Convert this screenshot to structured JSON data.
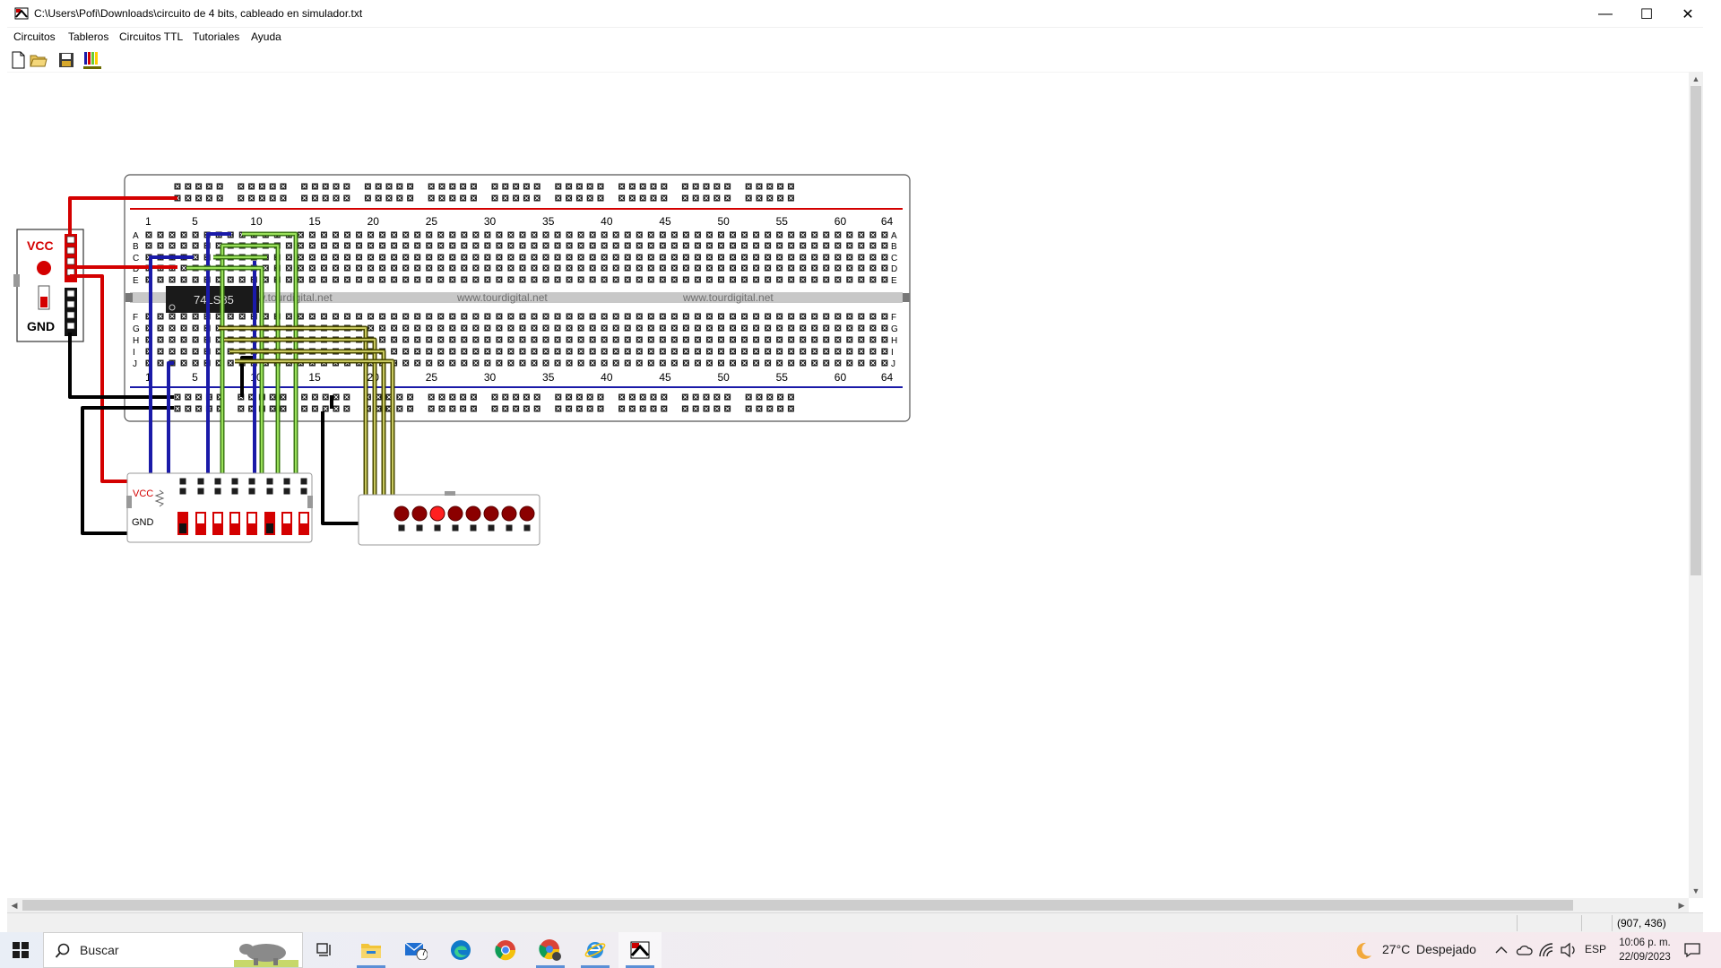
{
  "window": {
    "title": "C:\\Users\\Pofi\\Downloads\\circuito de  4 bits, cableado en simulador.txt",
    "minimize_glyph": "—",
    "maximize_glyph": "☐",
    "close_glyph": "✕"
  },
  "menu": [
    "Circuitos",
    "Tableros",
    "Circuitos TTL",
    "Tutoriales",
    "Ayuda"
  ],
  "toolbar": {
    "buttons": [
      "new-file-icon",
      "open-folder-icon",
      "save-disk-icon",
      "resistor-color-icon"
    ]
  },
  "breadboard": {
    "top_numbers": [
      "1",
      "5",
      "10",
      "15",
      "20",
      "25",
      "30",
      "35",
      "40",
      "45",
      "50",
      "55",
      "60",
      "64"
    ],
    "bottom_numbers": [
      "1",
      "5",
      "10",
      "15",
      "20",
      "25",
      "30",
      "35",
      "40",
      "45",
      "50",
      "55",
      "60",
      "64"
    ],
    "rows_top": [
      "A",
      "B",
      "C",
      "D",
      "E"
    ],
    "rows_bottom": [
      "F",
      "G",
      "H",
      "I",
      "J"
    ],
    "watermark": "www.tourdigital.net",
    "chip_label": "74LS85"
  },
  "power_module": {
    "vcc_label": "VCC",
    "gnd_label": "GND"
  },
  "dip_switch": {
    "vcc_label": "VCC",
    "gnd_label": "GND",
    "switch_count": 8
  },
  "led_bar": {
    "led_count": 8,
    "lit_index": 2
  },
  "status": {
    "coords": "(907, 436)"
  },
  "taskbar": {
    "search_placeholder": "Buscar",
    "mail_badge": "7",
    "weather_temp": "27°C",
    "weather_text": "Despejado",
    "language": "ESP",
    "time": "10:06 p. m.",
    "date": "22/09/2023"
  },
  "colors": {
    "vcc_wire": "#d40000",
    "gnd_wire": "#000000",
    "blue_wire": "#1a1aa8",
    "green_wire": "#66cc33",
    "olive_wire": "#6b6b00",
    "power_rail_red": "#d40000",
    "power_rail_blue": "#1a1aa8"
  }
}
